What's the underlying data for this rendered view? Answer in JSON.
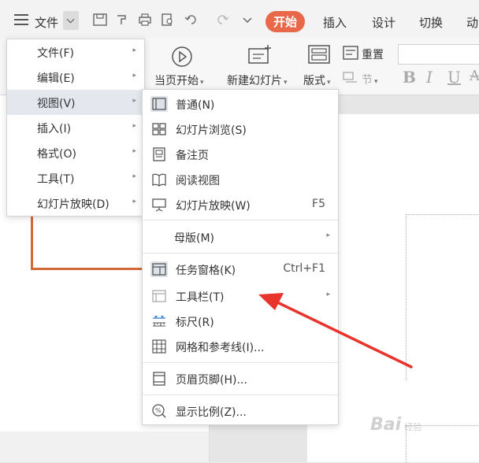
{
  "quick_access": {
    "file_menu_label": "文件",
    "icons": [
      "save-icon",
      "format-painter-icon",
      "print-icon",
      "print-preview-icon",
      "undo-icon",
      "redo-icon",
      "more-icon"
    ]
  },
  "tabs": [
    {
      "label": "开始",
      "active": true
    },
    {
      "label": "插入",
      "active": false
    },
    {
      "label": "设计",
      "active": false
    },
    {
      "label": "切换",
      "active": false
    },
    {
      "label": "动",
      "active": false
    }
  ],
  "ribbon": {
    "from_current": "当页开始",
    "new_slide": "新建幻灯片",
    "layout": "版式",
    "reset": "重置",
    "section": "节"
  },
  "menu_level1": [
    {
      "label": "文件(F)"
    },
    {
      "label": "编辑(E)"
    },
    {
      "label": "视图(V)",
      "highlighted": true
    },
    {
      "label": "插入(I)"
    },
    {
      "label": "格式(O)"
    },
    {
      "label": "工具(T)"
    },
    {
      "label": "幻灯片放映(D)"
    }
  ],
  "menu_view": {
    "normal": "普通(N)",
    "slide_sorter": "幻灯片浏览(S)",
    "notes_page": "备注页",
    "reading_view": "阅读视图",
    "slideshow": "幻灯片放映(W)",
    "slideshow_shortcut": "F5",
    "master": "母版(M)",
    "task_pane": "任务窗格(K)",
    "task_pane_shortcut": "Ctrl+F1",
    "toolbar": "工具栏(T)",
    "ruler": "标尺(R)",
    "grid_guides": "网格和参考线(I)...",
    "header_footer": "页眉页脚(H)...",
    "zoom": "显示比例(Z)..."
  },
  "colors": {
    "accent_tab": "#e8684a",
    "annotation_arrow": "#e8342a",
    "thumb_border": "#d26a38"
  },
  "watermark": {
    "text": "Bai",
    "sub": "经验"
  }
}
